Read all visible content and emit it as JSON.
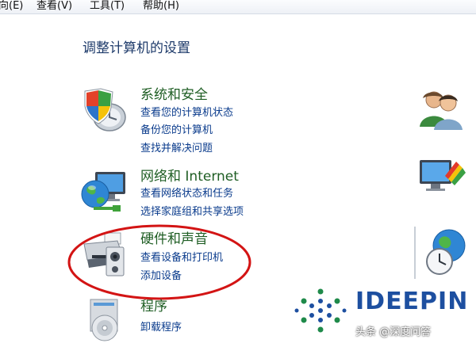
{
  "menubar": {
    "items": [
      {
        "label": "向(E)"
      },
      {
        "label": "查看(V)"
      },
      {
        "label": "工具(T)"
      },
      {
        "label": "帮助(H)"
      }
    ]
  },
  "page": {
    "title": "调整计算机的设置"
  },
  "categories": [
    {
      "title": "系统和安全",
      "icon": "shield-computer-icon",
      "links": [
        "查看您的计算机状态",
        "备份您的计算机",
        "查找并解决问题"
      ]
    },
    {
      "title": "网络和 Internet",
      "icon": "network-globe-icon",
      "links": [
        "查看网络状态和任务",
        "选择家庭组和共享选项"
      ]
    },
    {
      "title": "硬件和声音",
      "icon": "printer-speaker-icon",
      "links": [
        "查看设备和打印机",
        "添加设备"
      ]
    },
    {
      "title": "程序",
      "icon": "programs-disc-icon",
      "links": [
        "卸载程序"
      ]
    }
  ],
  "right_icons": [
    "user-accounts-icon",
    "appearance-monitor-icon",
    "clock-globe-icon"
  ],
  "watermark": {
    "logo": "deepin-dots-logo-icon",
    "brand": "IDEEPIN",
    "caption": "头条 @深度问答"
  },
  "colors": {
    "category_title": "#1f5e24",
    "link": "#0a3b8c",
    "highlight": "#d31414",
    "brand": "#1d4fa0"
  }
}
